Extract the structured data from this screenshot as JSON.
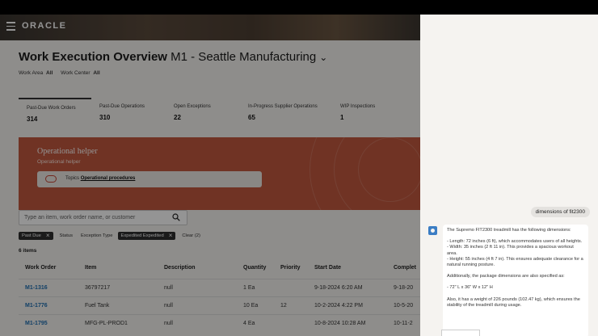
{
  "app": {
    "brand": "ORACLE",
    "title_bold": "Work Execution Overview",
    "title_rest": "M1 - Seattle Manufacturing",
    "filters": {
      "work_area_label": "Work Area",
      "work_area_value": "All",
      "work_center_label": "Work Center",
      "work_center_value": "All"
    },
    "metrics": [
      {
        "label": "Past-Due Work Orders",
        "value": "314"
      },
      {
        "label": "Past-Due Operations",
        "value": "310"
      },
      {
        "label": "Open Exceptions",
        "value": "22"
      },
      {
        "label": "In-Progress Supplier Operations",
        "value": "65"
      },
      {
        "label": "WIP Inspections",
        "value": "1"
      }
    ],
    "helper": {
      "title": "Operational helper",
      "subtitle": "Operational helper",
      "topics_label": "Topics",
      "topics_link": "Operational procedures"
    },
    "search_placeholder": "Type an item, work order name, or customer",
    "chips": {
      "past_due": "Past Due",
      "status": "Status",
      "exception_type": "Exception Type",
      "expedited": "Expedited Expedited",
      "clear": "Clear (2)"
    },
    "items_count": "6 items",
    "table": {
      "headers": [
        "Work Order",
        "Item",
        "Description",
        "Quantity",
        "Priority",
        "Start Date",
        "Complet"
      ],
      "rows": [
        [
          "M1-1316",
          "36797217",
          "null",
          "1 Ea",
          "",
          "9-18-2024 6:20 AM",
          "9-18-20"
        ],
        [
          "M1-1776",
          "Fuel Tank",
          "null",
          "10 Ea",
          "12",
          "10-2-2024 4:22 PM",
          "10-5-20"
        ],
        [
          "M1-1795",
          "MFG-PL-PROD1",
          "null",
          "4 Ea",
          "",
          "10-8-2024 10:28 AM",
          "10-11-2"
        ]
      ]
    }
  },
  "chat": {
    "user_message": "dimensions of fit2300",
    "bot_intro": "The Supremo FIT2300 treadmill has the following dimensions:",
    "bot_lines": [
      "- Length: 72 inches (6 ft), which accommodates users of all heights.",
      "- Width: 35 inches (2 ft 11 in). This provides a spacious workout area.",
      "- Height: 55 inches (4 ft 7 in). This ensures adequate clearance for a natural running posture."
    ],
    "bot_package_intro": "Additionally, the package dimensions are also specified as:",
    "bot_package": "- 72\" L x 36\" W x 12\" H",
    "bot_weight": "Also, it has a weight of 226 pounds (102.47 kg), which ensures the stability of the treadmill during usage."
  },
  "colors": {
    "helper_banner": "#c2593f",
    "link": "#1f6fb0",
    "dark_chip": "#2f2f2f"
  }
}
